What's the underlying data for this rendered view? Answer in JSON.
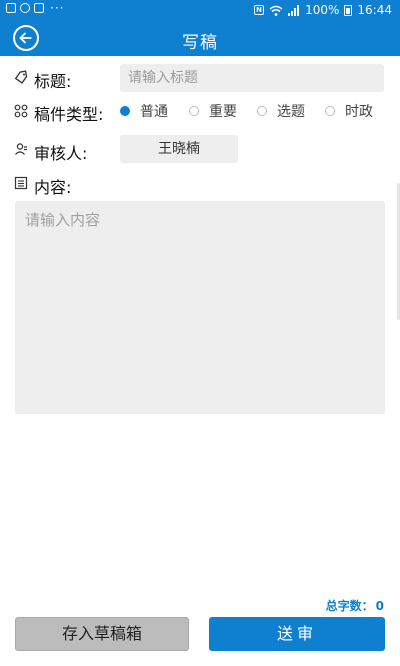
{
  "status_bar": {
    "dots": "···",
    "battery_percent": "100%",
    "time": "16:44"
  },
  "header": {
    "title": "写稿"
  },
  "form": {
    "title_label": "标题:",
    "title_placeholder": "请输入标题",
    "title_value": "",
    "type_label": "稿件类型:",
    "type_options": [
      "普通",
      "重要",
      "选题",
      "时政"
    ],
    "type_selected": "普通",
    "reviewer_label": "审核人:",
    "reviewer_value": "王晓楠",
    "content_label": "内容:",
    "content_placeholder": "请输入内容",
    "content_value": ""
  },
  "footer": {
    "word_count_label": "总字数：",
    "word_count": "0",
    "draft_button": "存入草稿箱",
    "submit_button": "送审"
  },
  "colors": {
    "primary": "#0f7fd0",
    "input_bg": "#eeeeee",
    "draft_button_bg": "#bcbcbc"
  }
}
